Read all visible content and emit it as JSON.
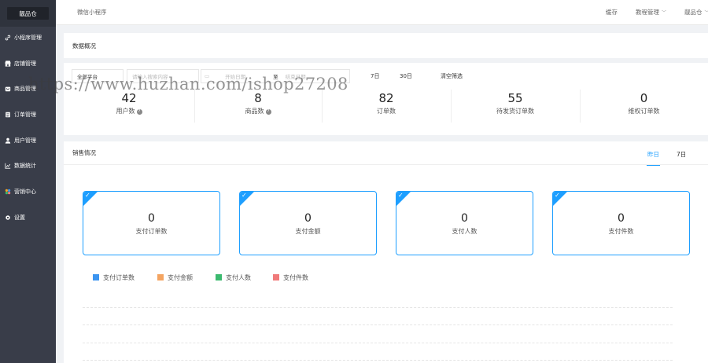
{
  "sidebar": {
    "logo": "靓品仓",
    "items": [
      {
        "label": "小程序管理",
        "icon": "link-icon"
      },
      {
        "label": "店铺管理",
        "icon": "shop-icon"
      },
      {
        "label": "商品管理",
        "icon": "cart-icon"
      },
      {
        "label": "订单管理",
        "icon": "order-icon"
      },
      {
        "label": "用户管理",
        "icon": "user-icon"
      },
      {
        "label": "数据统计",
        "icon": "chart-icon"
      },
      {
        "label": "营销中心",
        "icon": "marketing-icon"
      },
      {
        "label": "设置",
        "icon": "gear-icon"
      }
    ]
  },
  "header": {
    "title": "微信小程序",
    "cache": "缓存",
    "manager": "教程管理",
    "account": "靓品仓"
  },
  "overview": {
    "title": "数据概况",
    "filter": {
      "platform": "全部平台",
      "search_placeholder": "请输入搜索内容",
      "start_placeholder": "开始日期",
      "to": "至",
      "end_placeholder": "结束日期",
      "range_7": "7日",
      "range_30": "30日",
      "clear": "清空筛选"
    },
    "stats": [
      {
        "value": "42",
        "label": "用户数",
        "help": true
      },
      {
        "value": "8",
        "label": "商品数",
        "help": true
      },
      {
        "value": "82",
        "label": "订单数",
        "help": false
      },
      {
        "value": "55",
        "label": "待发货订单数",
        "help": false
      },
      {
        "value": "0",
        "label": "维权订单数",
        "help": false
      }
    ],
    "help_glyph": "?"
  },
  "sales": {
    "title": "销售情况",
    "tabs": [
      {
        "label": "昨日",
        "active": true
      },
      {
        "label": "7日",
        "active": false
      }
    ],
    "cards": [
      {
        "value": "0",
        "label": "支付订单数"
      },
      {
        "value": "0",
        "label": "支付金额"
      },
      {
        "value": "0",
        "label": "支付人数"
      },
      {
        "value": "0",
        "label": "支付件数"
      }
    ],
    "legend": [
      {
        "label": "支付订单数",
        "color": "#3c95f0"
      },
      {
        "label": "支付金额",
        "color": "#f4a461"
      },
      {
        "label": "支付人数",
        "color": "#3cba6f"
      },
      {
        "label": "支付件数",
        "color": "#f07a7a"
      }
    ]
  },
  "colors": {
    "accent": "#1e9fff",
    "sidebar": "#393d49"
  },
  "watermark": "https://www.huzhan.com/ishop27208"
}
